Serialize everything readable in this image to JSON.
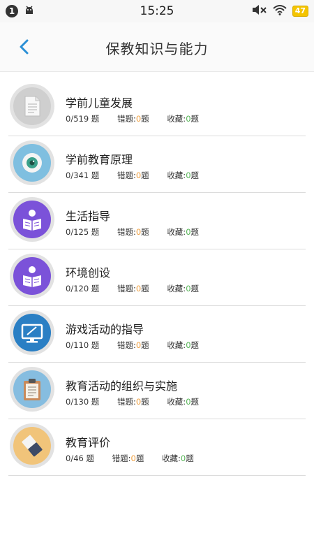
{
  "status_bar": {
    "notification_count": "1",
    "time": "15:25",
    "battery_level": "47"
  },
  "header": {
    "title": "保教知识与能力"
  },
  "colors": {
    "accent_blue": "#2a8fd6",
    "wrong_count": "#f0a040",
    "fav_count": "#55b455"
  },
  "items": [
    {
      "title": "学前儿童发展",
      "progress": "0/519 题",
      "wrong_label": "错题:",
      "wrong_count": "0",
      "wrong_unit": "题",
      "fav_label": "收藏:",
      "fav_count": "0",
      "fav_unit": "题",
      "icon": "document-icon"
    },
    {
      "title": "学前教育原理",
      "progress": "0/341 题",
      "wrong_label": "错题:",
      "wrong_count": "0",
      "wrong_unit": "题",
      "fav_label": "收藏:",
      "fav_count": "0",
      "fav_unit": "题",
      "icon": "eye-icon"
    },
    {
      "title": "生活指导",
      "progress": "0/125 题",
      "wrong_label": "错题:",
      "wrong_count": "0",
      "wrong_unit": "题",
      "fav_label": "收藏:",
      "fav_count": "0",
      "fav_unit": "题",
      "icon": "reader-icon"
    },
    {
      "title": "环境创设",
      "progress": "0/120 题",
      "wrong_label": "错题:",
      "wrong_count": "0",
      "wrong_unit": "题",
      "fav_label": "收藏:",
      "fav_count": "0",
      "fav_unit": "题",
      "icon": "reader-icon"
    },
    {
      "title": "游戏活动的指导",
      "progress": "0/110 题",
      "wrong_label": "错题:",
      "wrong_count": "0",
      "wrong_unit": "题",
      "fav_label": "收藏:",
      "fav_count": "0",
      "fav_unit": "题",
      "icon": "monitor-icon"
    },
    {
      "title": "教育活动的组织与实施",
      "progress": "0/130 题",
      "wrong_label": "错题:",
      "wrong_count": "0",
      "wrong_unit": "题",
      "fav_label": "收藏:",
      "fav_count": "0",
      "fav_unit": "题",
      "icon": "clipboard-icon"
    },
    {
      "title": "教育评价",
      "progress": "0/46 题",
      "wrong_label": "错题:",
      "wrong_count": "0",
      "wrong_unit": "题",
      "fav_label": "收藏:",
      "fav_count": "0",
      "fav_unit": "题",
      "icon": "eraser-icon"
    }
  ]
}
